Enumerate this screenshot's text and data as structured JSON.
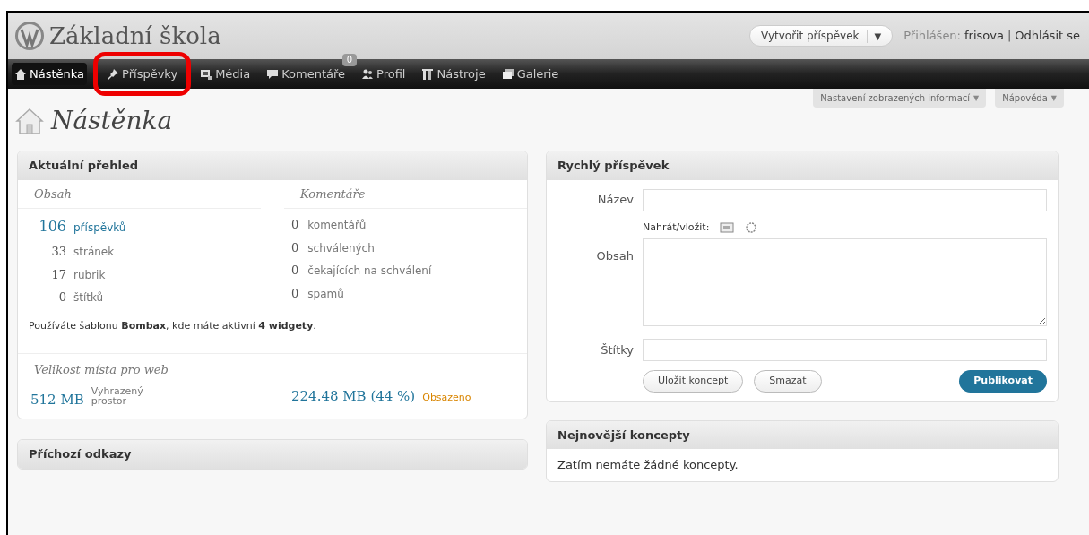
{
  "site_title": "Základní škola",
  "header": {
    "new_post_button": "Vytvořit příspěvek",
    "dropdown_caret": "▼",
    "logged_in_label": "Přihlášen:",
    "user": "frisova",
    "separator": "|",
    "logout": "Odhlásit se"
  },
  "menu": [
    {
      "label": "Nástěnka",
      "selected": true,
      "highlighted": false
    },
    {
      "label": "Příspěvky",
      "selected": false,
      "highlighted": true
    },
    {
      "label": "Média",
      "selected": false,
      "highlighted": false
    },
    {
      "label": "Komentáře",
      "selected": false,
      "highlighted": false,
      "badge": "0"
    },
    {
      "label": "Profil",
      "selected": false,
      "highlighted": false
    },
    {
      "label": "Nástroje",
      "selected": false,
      "highlighted": false
    },
    {
      "label": "Galerie",
      "selected": false,
      "highlighted": false
    }
  ],
  "screen_tabs": [
    {
      "label": "Nastavení zobrazených informací",
      "caret": "▼"
    },
    {
      "label": "Nápověda",
      "caret": "▼"
    }
  ],
  "page_title": "Nástěnka",
  "overview": {
    "title": "Aktuální přehled",
    "content_heading": "Obsah",
    "comments_heading": "Komentáře",
    "content_rows": [
      {
        "count": "106",
        "label": "příspěvků"
      },
      {
        "count": "33",
        "label": "stránek"
      },
      {
        "count": "17",
        "label": "rubrik"
      },
      {
        "count": "0",
        "label": "štítků"
      }
    ],
    "comment_rows": [
      {
        "count": "0",
        "label": "komentářů"
      },
      {
        "count": "0",
        "label": "schválených"
      },
      {
        "count": "0",
        "label": "čekajících na schválení"
      },
      {
        "count": "0",
        "label": "spamů"
      }
    ],
    "theme_note": "Používáte šablonu **Bombax**, kde máte aktivní **4 widgety**.",
    "storage_heading": "Velikost místa pro web",
    "allowed": "512 MB",
    "allowed_label": "Vyhrazený prostor",
    "used": "224.48 MB (44 %)",
    "used_label": "Obsazeno"
  },
  "incoming_links": {
    "title": "Příchozí odkazy"
  },
  "quick_post": {
    "title": "Rychlý příspěvek",
    "title_label": "Název",
    "upload_label": "Nahrát/vložit:",
    "content_label": "Obsah",
    "tags_label": "Štítky",
    "save_draft": "Uložit koncept",
    "reset": "Smazat",
    "publish": "Publikovat"
  },
  "recent_drafts": {
    "title": "Nejnovější koncepty",
    "empty": "Zatím nemáte žádné koncepty."
  }
}
